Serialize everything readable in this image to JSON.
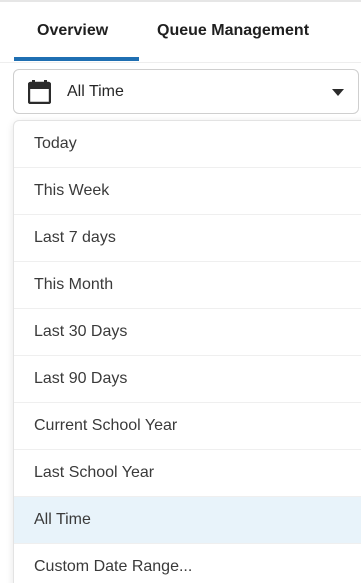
{
  "tabs": [
    {
      "label": "Overview",
      "active": true
    },
    {
      "label": "Queue Management",
      "active": false
    }
  ],
  "colors": {
    "accent": "#1f6fb2",
    "selected_bg": "#e8f3fa",
    "icon": "#2b2b2b"
  },
  "date_filter": {
    "icon": "calendar-icon",
    "value": "All Time",
    "caret_icon": "caret-down-icon",
    "options": [
      {
        "label": "Today"
      },
      {
        "label": "This Week"
      },
      {
        "label": "Last 7 days"
      },
      {
        "label": "This Month"
      },
      {
        "label": "Last 30 Days"
      },
      {
        "label": "Last 90 Days"
      },
      {
        "label": "Current School Year"
      },
      {
        "label": "Last School Year"
      },
      {
        "label": "All Time",
        "selected": true
      },
      {
        "label": "Custom Date Range..."
      }
    ]
  }
}
